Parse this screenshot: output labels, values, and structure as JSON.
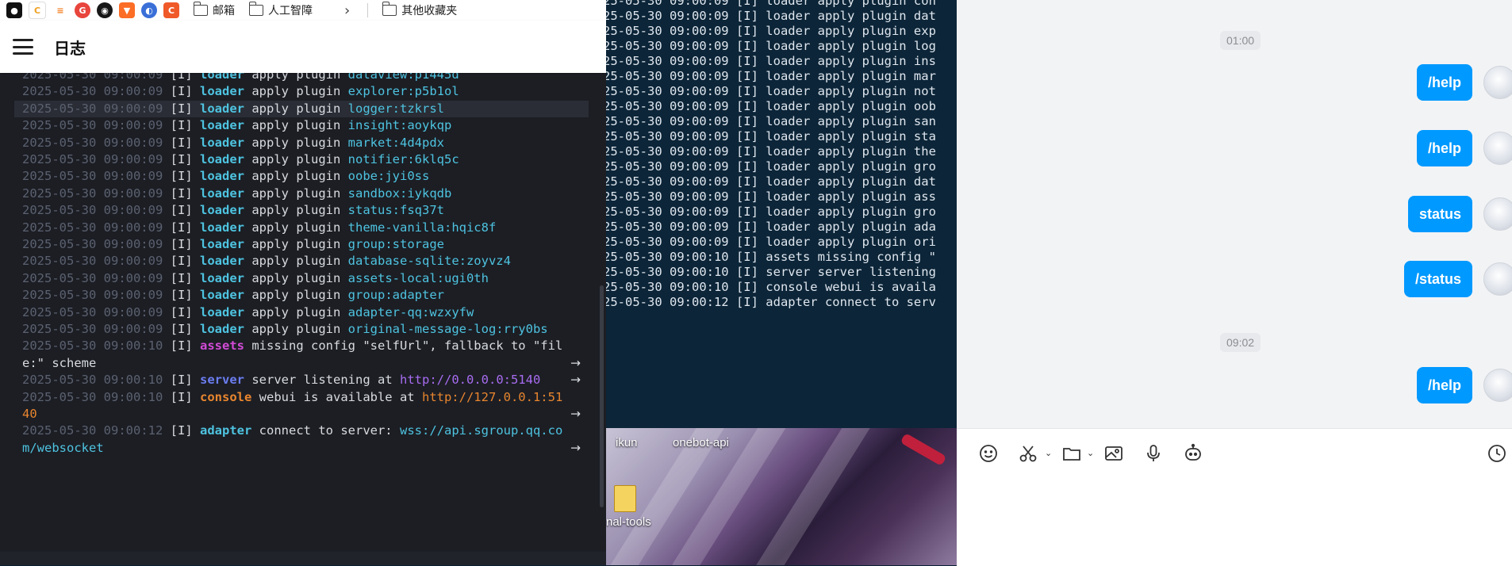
{
  "colors": {
    "log_background": "#1c1e24",
    "timestamp": "#5b6170",
    "module_loader": "#4ec3e0",
    "module_assets": "#d24bd6",
    "module_server": "#6b7df2",
    "module_console": "#e8852e",
    "module_adapter": "#4ec3e0",
    "arg_cyan": "#4ec3e0",
    "url_purple": "#a86cf0",
    "terminal_background": "#0c2538",
    "chat_bubble": "#0099ff"
  },
  "bookmarks_bar": {
    "icons": [
      "app-icon-1",
      "app-icon-2",
      "stackoverflow-icon",
      "google-icon",
      "github-icon",
      "gitlab-icon",
      "chrome-app-icon",
      "c-app-icon"
    ],
    "folders": [
      "邮箱",
      "人工智障"
    ],
    "other_folder": "其他收藏夹"
  },
  "log_page": {
    "title": "日志",
    "lines": [
      {
        "ts": "2025-05-30 09:00:09",
        "lv": "[I]",
        "mod": "loader",
        "mod_color": "#4ec3e0",
        "msg": "apply plugin",
        "arg": "dataview:p1445d"
      },
      {
        "ts": "2025-05-30 09:00:09",
        "lv": "[I]",
        "mod": "loader",
        "mod_color": "#4ec3e0",
        "msg": "apply plugin",
        "arg": "explorer:p5b1ol"
      },
      {
        "ts": "2025-05-30 09:00:09",
        "lv": "[I]",
        "mod": "loader",
        "mod_color": "#4ec3e0",
        "msg": "apply plugin",
        "arg": "logger:tzkrsl",
        "highlight": true
      },
      {
        "ts": "2025-05-30 09:00:09",
        "lv": "[I]",
        "mod": "loader",
        "mod_color": "#4ec3e0",
        "msg": "apply plugin",
        "arg": "insight:aoykqp"
      },
      {
        "ts": "2025-05-30 09:00:09",
        "lv": "[I]",
        "mod": "loader",
        "mod_color": "#4ec3e0",
        "msg": "apply plugin",
        "arg": "market:4d4pdx"
      },
      {
        "ts": "2025-05-30 09:00:09",
        "lv": "[I]",
        "mod": "loader",
        "mod_color": "#4ec3e0",
        "msg": "apply plugin",
        "arg": "notifier:6klq5c"
      },
      {
        "ts": "2025-05-30 09:00:09",
        "lv": "[I]",
        "mod": "loader",
        "mod_color": "#4ec3e0",
        "msg": "apply plugin",
        "arg": "oobe:jyi0ss"
      },
      {
        "ts": "2025-05-30 09:00:09",
        "lv": "[I]",
        "mod": "loader",
        "mod_color": "#4ec3e0",
        "msg": "apply plugin",
        "arg": "sandbox:iykqdb"
      },
      {
        "ts": "2025-05-30 09:00:09",
        "lv": "[I]",
        "mod": "loader",
        "mod_color": "#4ec3e0",
        "msg": "apply plugin",
        "arg": "status:fsq37t"
      },
      {
        "ts": "2025-05-30 09:00:09",
        "lv": "[I]",
        "mod": "loader",
        "mod_color": "#4ec3e0",
        "msg": "apply plugin",
        "arg": "theme-vanilla:hqic8f"
      },
      {
        "ts": "2025-05-30 09:00:09",
        "lv": "[I]",
        "mod": "loader",
        "mod_color": "#4ec3e0",
        "msg": "apply plugin",
        "arg": "group:storage"
      },
      {
        "ts": "2025-05-30 09:00:09",
        "lv": "[I]",
        "mod": "loader",
        "mod_color": "#4ec3e0",
        "msg": "apply plugin",
        "arg": "database-sqlite:zoyvz4"
      },
      {
        "ts": "2025-05-30 09:00:09",
        "lv": "[I]",
        "mod": "loader",
        "mod_color": "#4ec3e0",
        "msg": "apply plugin",
        "arg": "assets-local:ugi0th"
      },
      {
        "ts": "2025-05-30 09:00:09",
        "lv": "[I]",
        "mod": "loader",
        "mod_color": "#4ec3e0",
        "msg": "apply plugin",
        "arg": "group:adapter"
      },
      {
        "ts": "2025-05-30 09:00:09",
        "lv": "[I]",
        "mod": "loader",
        "mod_color": "#4ec3e0",
        "msg": "apply plugin",
        "arg": "adapter-qq:wzxyfw"
      },
      {
        "ts": "2025-05-30 09:00:09",
        "lv": "[I]",
        "mod": "loader",
        "mod_color": "#4ec3e0",
        "msg": "apply plugin",
        "arg": "original-message-log:rry0bs"
      },
      {
        "ts": "2025-05-30 09:00:10",
        "lv": "[I]",
        "mod": "assets",
        "mod_color": "#d24bd6",
        "msg": "missing config \"selfUrl\", fallback to \"fil",
        "cont": "e:\" scheme",
        "arrow": true
      },
      {
        "ts": "2025-05-30 09:00:10",
        "lv": "[I]",
        "mod": "server",
        "mod_color": "#6b7df2",
        "msg": "server listening at",
        "url": "http://0.0.0.0:5140",
        "url_color": "#a86cf0",
        "arrow": true
      },
      {
        "ts": "2025-05-30 09:00:10",
        "lv": "[I]",
        "mod": "console",
        "mod_color": "#e8852e",
        "msg": "webui is available at",
        "url": "http://127.0.0.1:51",
        "url_color": "#e8852e",
        "cont": "40",
        "cont_color": "#e8852e",
        "arrow": true
      },
      {
        "ts": "2025-05-30 09:00:12",
        "lv": "[I]",
        "mod": "adapter",
        "mod_color": "#4ec3e0",
        "msg": "connect to server:",
        "url": "wss://api.sgroup.qq.co",
        "url_color": "#4ec3e0",
        "cont": "m/websocket",
        "cont_color": "#4ec3e0",
        "arrow": true
      }
    ]
  },
  "terminal": {
    "lines": [
      "25-05-30 09:00:09 [I] loader apply plugin con",
      "25-05-30 09:00:09 [I] loader apply plugin dat",
      "25-05-30 09:00:09 [I] loader apply plugin exp",
      "25-05-30 09:00:09 [I] loader apply plugin log",
      "25-05-30 09:00:09 [I] loader apply plugin ins",
      "25-05-30 09:00:09 [I] loader apply plugin mar",
      "25-05-30 09:00:09 [I] loader apply plugin not",
      "25-05-30 09:00:09 [I] loader apply plugin oob",
      "25-05-30 09:00:09 [I] loader apply plugin san",
      "25-05-30 09:00:09 [I] loader apply plugin sta",
      "25-05-30 09:00:09 [I] loader apply plugin the",
      "25-05-30 09:00:09 [I] loader apply plugin gro",
      "25-05-30 09:00:09 [I] loader apply plugin dat",
      "25-05-30 09:00:09 [I] loader apply plugin ass",
      "25-05-30 09:00:09 [I] loader apply plugin gro",
      "25-05-30 09:00:09 [I] loader apply plugin ada",
      "25-05-30 09:00:09 [I] loader apply plugin ori",
      "25-05-30 09:00:10 [I] assets missing config \"",
      "25-05-30 09:00:10 [I] server server listening",
      "25-05-30 09:00:10 [I] console webui is availa",
      "25-05-30 09:00:12 [I] adapter connect to serv"
    ]
  },
  "desktop": {
    "icons": [
      {
        "label": "ikun"
      },
      {
        "label": "onebot-api"
      },
      {
        "label": "nal-tools"
      }
    ]
  },
  "chat": {
    "time_chips": [
      "01:00",
      "09:02"
    ],
    "messages": [
      {
        "text": "/help"
      },
      {
        "text": "/help"
      },
      {
        "text": "status"
      },
      {
        "text": "/status"
      },
      {
        "text": "/help"
      }
    ],
    "toolbar": [
      "emoji-icon",
      "scissors-icon",
      "folder-icon",
      "image-icon",
      "microphone-icon",
      "robot-icon",
      "clock-icon"
    ]
  }
}
